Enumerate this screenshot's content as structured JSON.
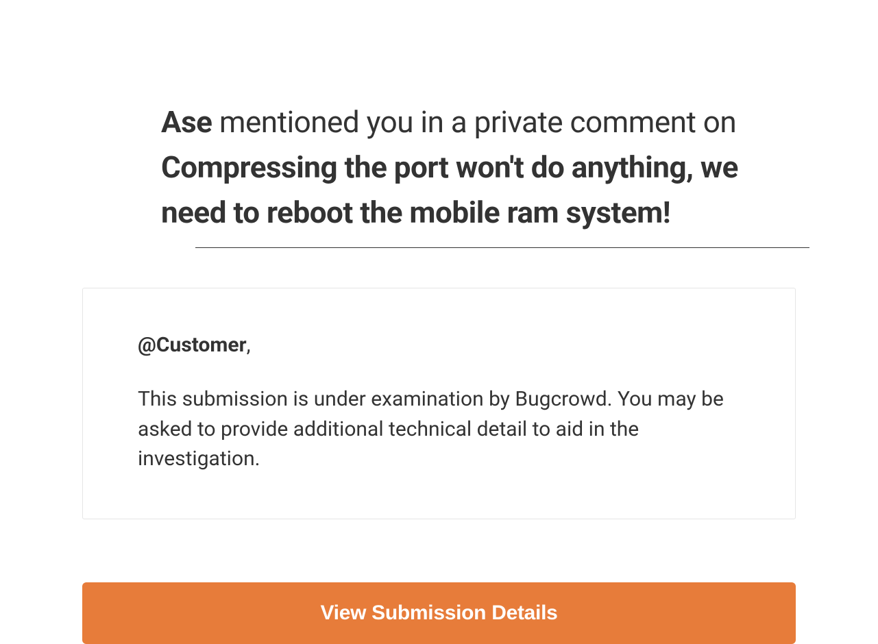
{
  "heading": {
    "actor": "Ase",
    "middle": " mentioned you in a private comment on ",
    "subject": "Compressing the port won't do anything, we need to reboot the mobile ram system!"
  },
  "comment": {
    "mention": "@Customer",
    "mention_suffix": ",",
    "body": "This submission is under examination by Bugcrowd. You may be asked to provide additional technical detail to aid in the investigation."
  },
  "cta": {
    "label": "View Submission Details"
  }
}
